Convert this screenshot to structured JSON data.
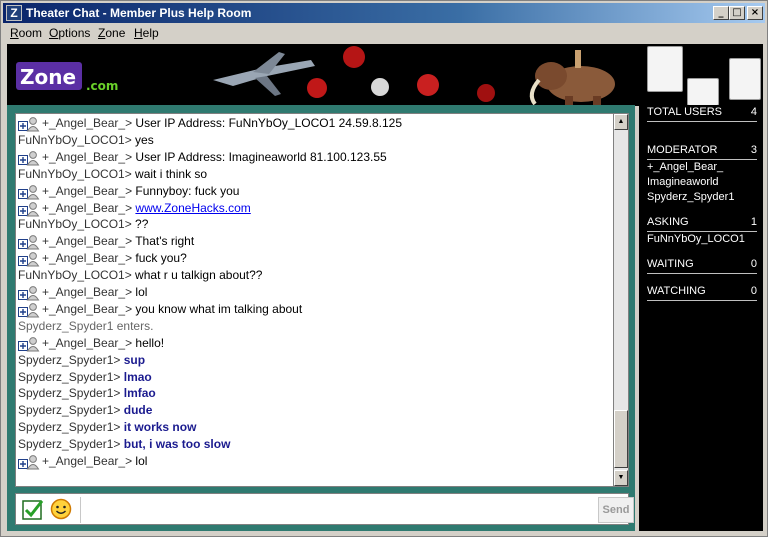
{
  "window": {
    "title": "Theater Chat - Member Plus Help Room",
    "app_icon_letter": "Z",
    "controls": {
      "minimize": "_",
      "maximize": "□",
      "close": "×"
    }
  },
  "menu": [
    {
      "label": "Room",
      "key": "R"
    },
    {
      "label": "Options",
      "key": "O"
    },
    {
      "label": "Zone",
      "key": "Z"
    },
    {
      "label": "Help",
      "key": "H"
    }
  ],
  "banner": {
    "logo_text": "Zone",
    "logo_suffix": ".com"
  },
  "users_panel": {
    "total_users": {
      "label": "TOTAL USERS",
      "count": "4"
    },
    "moderator": {
      "label": "MODERATOR",
      "count": "3",
      "users": [
        "+_Angel_Bear_",
        "Imagineaworld",
        "Spyderz_Spyder1"
      ]
    },
    "asking": {
      "label": "ASKING",
      "count": "1",
      "users": [
        "FuNnYbOy_LOCO1"
      ]
    },
    "waiting": {
      "label": "WAITING",
      "count": "0"
    },
    "watching": {
      "label": "WATCHING",
      "count": "0"
    }
  },
  "chat": {
    "messages": [
      {
        "icon": true,
        "name": "+_Angel_Bear_>",
        "text": " User IP Address: FuNnYbOy_LOCO1  24.59.8.125",
        "style": "normal"
      },
      {
        "icon": false,
        "name": "FuNnYbOy_LOCO1>",
        "text": " yes",
        "style": "normal"
      },
      {
        "icon": true,
        "name": "+_Angel_Bear_>",
        "text": " User IP Address: Imagineaworld  81.100.123.55",
        "style": "normal"
      },
      {
        "icon": false,
        "name": "FuNnYbOy_LOCO1>",
        "text": " wait i think so",
        "style": "normal"
      },
      {
        "icon": true,
        "name": "+_Angel_Bear_>",
        "text": " Funnyboy: fuck you",
        "style": "normal"
      },
      {
        "icon": true,
        "name": "+_Angel_Bear_>",
        "text": "www.ZoneHacks.com",
        "style": "link"
      },
      {
        "icon": false,
        "name": "FuNnYbOy_LOCO1>",
        "text": " ??",
        "style": "normal"
      },
      {
        "icon": true,
        "name": "+_Angel_Bear_>",
        "text": " That's right",
        "style": "normal"
      },
      {
        "icon": true,
        "name": "+_Angel_Bear_>",
        "text": " fuck you?",
        "style": "normal"
      },
      {
        "icon": false,
        "name": "FuNnYbOy_LOCO1>",
        "text": " what r u talkign about??",
        "style": "normal"
      },
      {
        "icon": true,
        "name": "+_Angel_Bear_>",
        "text": " lol",
        "style": "normal"
      },
      {
        "icon": true,
        "name": "+_Angel_Bear_>",
        "text": " you know what im talking about",
        "style": "normal"
      },
      {
        "icon": false,
        "name": "",
        "text": "Spyderz_Spyder1 enters.",
        "style": "system"
      },
      {
        "icon": true,
        "name": "+_Angel_Bear_>",
        "text": " hello!",
        "style": "normal"
      },
      {
        "icon": false,
        "name": "Spyderz_Spyder1>",
        "text": " sup",
        "style": "bold"
      },
      {
        "icon": false,
        "name": "Spyderz_Spyder1>",
        "text": " lmao",
        "style": "bold"
      },
      {
        "icon": false,
        "name": "Spyderz_Spyder1>",
        "text": " lmfao",
        "style": "bold"
      },
      {
        "icon": false,
        "name": "Spyderz_Spyder1>",
        "text": " dude",
        "style": "bold"
      },
      {
        "icon": false,
        "name": "Spyderz_Spyder1>",
        "text": " it works now",
        "style": "bold"
      },
      {
        "icon": false,
        "name": "Spyderz_Spyder1>",
        "text": " but, i was too slow",
        "style": "bold"
      },
      {
        "icon": true,
        "name": "+_Angel_Bear_>",
        "text": " lol",
        "style": "normal"
      }
    ]
  },
  "input": {
    "value": "",
    "send_label": "Send"
  }
}
